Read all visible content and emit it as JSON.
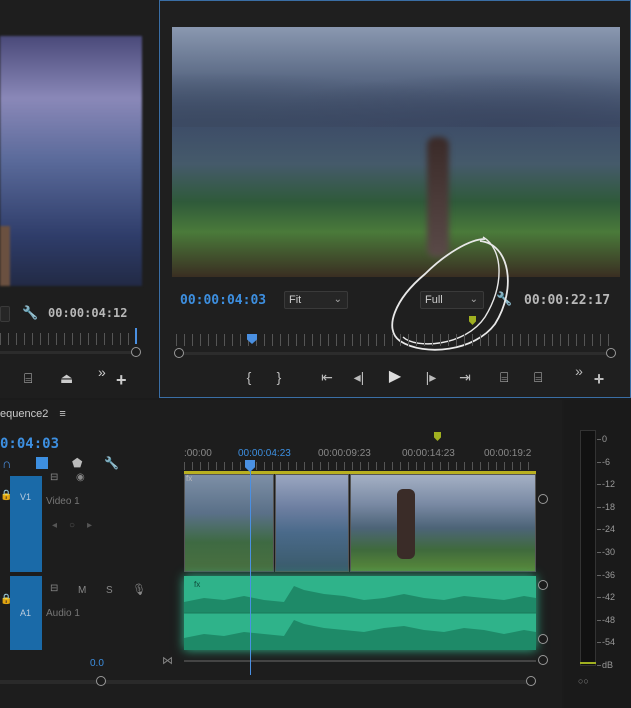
{
  "source_monitor": {
    "timecode": "00:00:04:12"
  },
  "program_monitor": {
    "timecode": "00:00:04:03",
    "zoom_label": "Fit",
    "quality_label": "Full",
    "duration": "00:00:22:17",
    "transport": {
      "mark_in": "{",
      "mark_out": "}",
      "go_in": "⇤",
      "step_back": "◂|",
      "play": "▶",
      "step_fwd": "|▸",
      "go_out": "⇥",
      "more": "»",
      "add": "+"
    }
  },
  "timeline": {
    "sequence_name": "equence2",
    "menu_icon": "≡",
    "timecode": "0:04:03",
    "ruler_labels": [
      ":00:00",
      "00:00:04:23",
      "00:00:09:23",
      "00:00:14:23",
      "00:00:19:2"
    ],
    "tracks": {
      "v1_id": "V1",
      "v1_name": "Video 1",
      "a1_id": "A1",
      "a1_name": "Audio 1",
      "m_label": "M",
      "s_label": "S",
      "clip_fx_v": "fx",
      "clip_fx_a": "fx"
    },
    "master_value": "0.0"
  },
  "meter": {
    "scale": [
      "0",
      "-6",
      "-12",
      "-18",
      "-24",
      "-30",
      "-36",
      "-42",
      "-48",
      "-54",
      "dB"
    ]
  },
  "colors": {
    "accent_blue": "#3d8fe0",
    "audio_green": "#2fb38a",
    "playhead_blue": "#4a90e2"
  }
}
